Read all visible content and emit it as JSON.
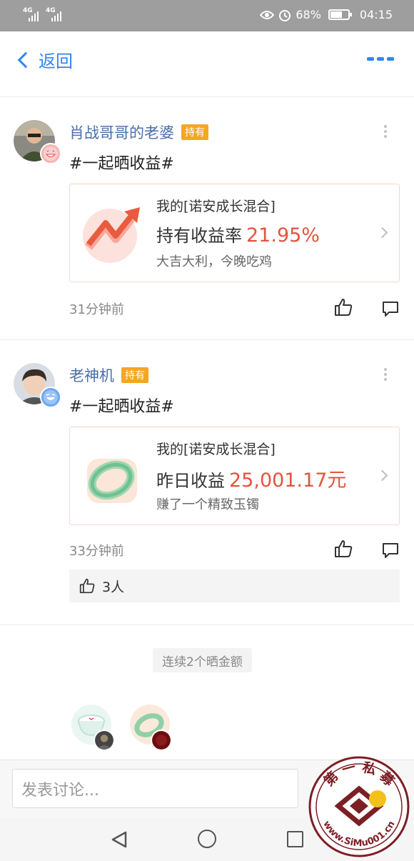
{
  "status_bar": {
    "signal1": "4G",
    "signal2": "4G",
    "battery": "68%",
    "time": "04:15"
  },
  "header": {
    "back_label": "返回"
  },
  "posts": [
    {
      "username": "肖战哥哥的老婆",
      "badge": "持有",
      "text": "#一起晒收益#",
      "card_line1": "我的[诺安成长混合]",
      "card_label": "持有收益率",
      "card_value": "21.95%",
      "card_line3": "大吉大利，今晚吃鸡",
      "time": "31分钟前"
    },
    {
      "username": "老神机",
      "badge": "持有",
      "text": "#一起晒收益#",
      "card_line1": "我的[诺安成长混合]",
      "card_label": "昨日收益",
      "card_value": "25,001.17元",
      "card_line3": "赚了一个精致玉镯",
      "time": "33分钟前",
      "likes": "3人"
    }
  ],
  "consecutive_label": "连续2个晒金额",
  "comment_placeholder": "发表讨论...",
  "watermark": {
    "top_text": "第 一 私 募",
    "url": "www.SiMu001.cn"
  },
  "colors": {
    "accent_blue": "#2f86f6",
    "value_red": "#e2543e",
    "badge_orange": "#f5a623",
    "username_blue": "#4a6ea9"
  }
}
